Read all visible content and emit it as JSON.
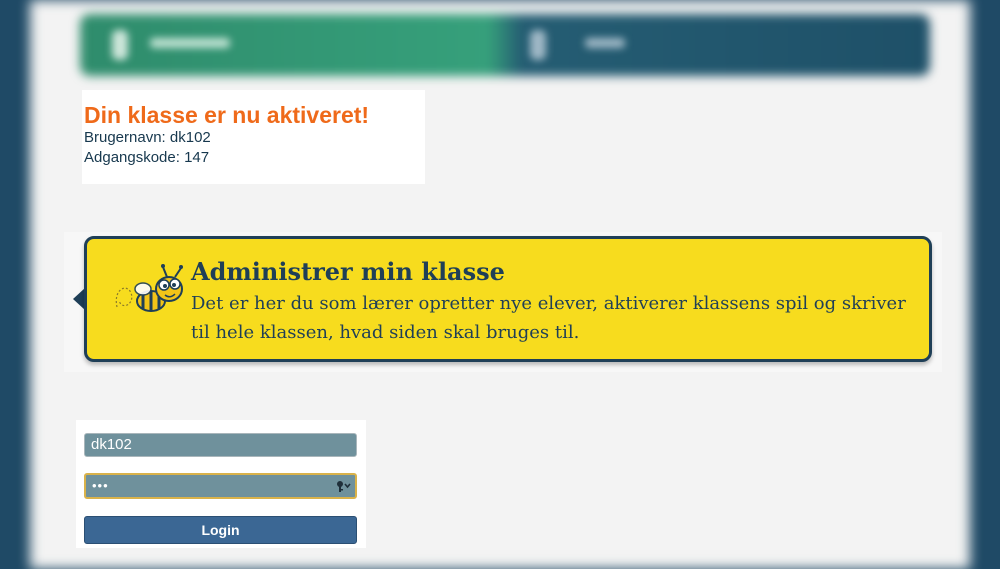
{
  "notice": {
    "title": "Din klasse er nu aktiveret!",
    "username_line": "Brugernavn: dk102",
    "password_line": "Adgangskode: 147"
  },
  "callout": {
    "title": "Administrer min klasse",
    "text": "Det er her du som lærer opretter nye elever, aktiverer klassens spil og skriver til hele klassen, hvad siden skal bruges til.",
    "bg_color": "#f7dc1e",
    "border_color": "#1f3f57",
    "icon": "bee-icon"
  },
  "login": {
    "username_value": "dk102",
    "password_value": "•••",
    "button_label": "Login",
    "key_icon": "key-icon"
  },
  "colors": {
    "accent": "#ef6a1a",
    "background": "#1f4a66",
    "nav_green": "#36a07b",
    "nav_blue": "#1e5068"
  }
}
